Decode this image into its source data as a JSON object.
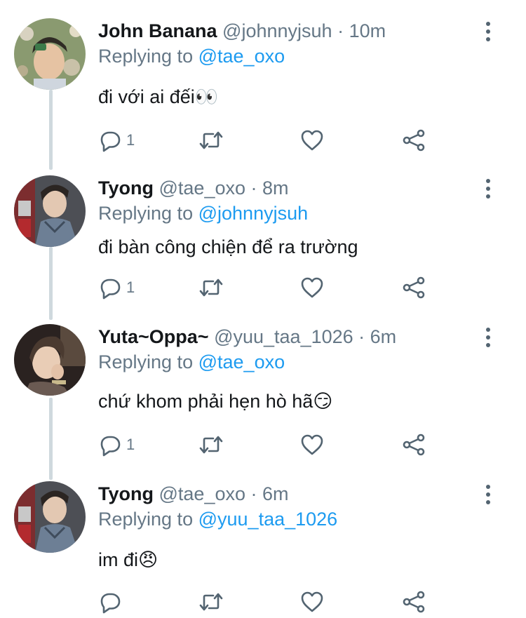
{
  "tweets": [
    {
      "name": "John Banana",
      "handle": "@johnnyjsuh",
      "time": "10m",
      "replying_label": "Replying to",
      "replying_to": "@tae_oxo",
      "text": "đi với ai đếi👀",
      "reply_count": "1"
    },
    {
      "name": "Tyong",
      "handle": "@tae_oxo",
      "time": "8m",
      "replying_label": "Replying to",
      "replying_to": "@johnnyjsuh",
      "text": "đi bàn công chiện để ra trường",
      "reply_count": "1"
    },
    {
      "name": "Yuta~Oppa~",
      "handle": "@yuu_taa_1026",
      "time": "6m",
      "replying_label": "Replying to",
      "replying_to": "@tae_oxo",
      "text": "chứ khom phải hẹn hò hã😏",
      "reply_count": "1"
    },
    {
      "name": "Tyong",
      "handle": "@tae_oxo",
      "time": "6m",
      "replying_label": "Replying to",
      "replying_to": "@yuu_taa_1026",
      "text": "im đi😠",
      "reply_count": ""
    }
  ],
  "separator": " · ",
  "colors": {
    "text": "#14171a",
    "muted": "#657786",
    "link": "#1d9bf0",
    "icon": "#536471",
    "thread_line": "#cfd9de"
  },
  "icons": {
    "more": "vertical-dots-icon",
    "reply": "reply-bubble-icon",
    "retweet": "retweet-icon",
    "like": "heart-icon",
    "share": "share-icon"
  }
}
